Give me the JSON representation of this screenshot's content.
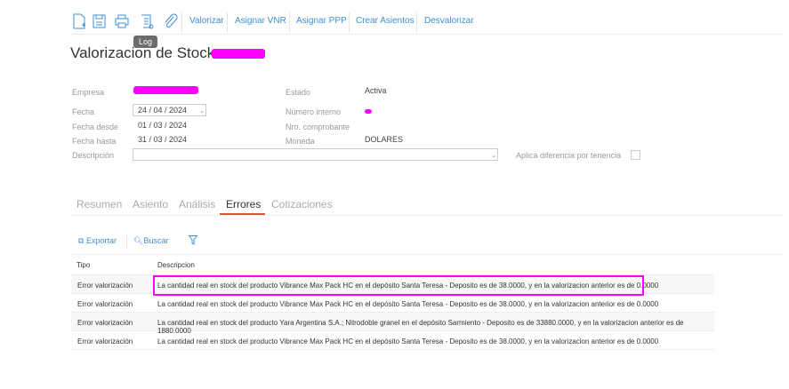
{
  "toolbar": {
    "icons": [
      "new-document-icon",
      "save-icon",
      "print-icon",
      "log-icon",
      "attachment-icon"
    ],
    "tooltip": "Log",
    "buttons": [
      "Valorizar",
      "Asignar VNR",
      "Asignar PPP",
      "Crear Asientos",
      "Desvalorizar"
    ]
  },
  "page_title": "Valorizacion de Stock - ",
  "form": {
    "empresa_label": "Empresa",
    "fecha_label": "Fecha",
    "fecha_value": "24 / 04 /  2024",
    "fecha_desde_label": "Fecha desde",
    "fecha_desde_value": "01 / 03 /  2024",
    "fecha_hasta_label": "Fecha hasta",
    "fecha_hasta_value": "31 / 03 /  2024",
    "descripcion_label": "Descripción",
    "descripcion_value": "",
    "estado_label": "Estado",
    "estado_value": "Activa",
    "numero_interno_label": "Número interno",
    "nro_comprobante_label": "Nro. comprobante",
    "moneda_label": "Moneda",
    "moneda_value": "DOLARES",
    "aplica_label": "Aplica diferencia por tenencia",
    "aplica_checked": false
  },
  "tabs": [
    {
      "label": "Resumen"
    },
    {
      "label": "Asiento"
    },
    {
      "label": "Análisis"
    },
    {
      "label": "Errores",
      "active": true
    },
    {
      "label": "Cotizaciones"
    }
  ],
  "grid_toolbar": {
    "export": "Exportar",
    "search": "Buscar"
  },
  "table": {
    "headers": [
      "Tipo",
      "Descripcion"
    ],
    "rows": [
      {
        "tipo": "Error valorización",
        "descripcion": "La cantidad real en stock del producto Vibrance Max Pack HC en el depósito Santa Teresa - Deposito es de 38.0000, y en la valorizacion anterior es de 0.0000"
      },
      {
        "tipo": "Error valorización",
        "descripcion": "La cantidad real en stock del producto Vibrance Max Pack HC en el depósito Santa Teresa - Deposito es de 38.0000, y en la valorizacion anterior es de 0.0000"
      },
      {
        "tipo": "Error valorización",
        "descripcion": "La cantidad real en stock del producto Yara Argentina S.A.; Nitrodoble granel en el depósito Sarmiento - Deposito es de 33880.0000, y en la valorizacion anterior es de 1880.0000"
      },
      {
        "tipo": "Error valorización",
        "descripcion": "La cantidad real en stock del producto Vibrance Max Pack HC en el depósito Santa Teresa - Deposito es de 38.0000, y en la valorizacion anterior es de 0.0000"
      }
    ]
  },
  "colors": {
    "accent": "#3d8fd6",
    "tab_active": "#e0533a",
    "highlight": "#ff00ff"
  }
}
